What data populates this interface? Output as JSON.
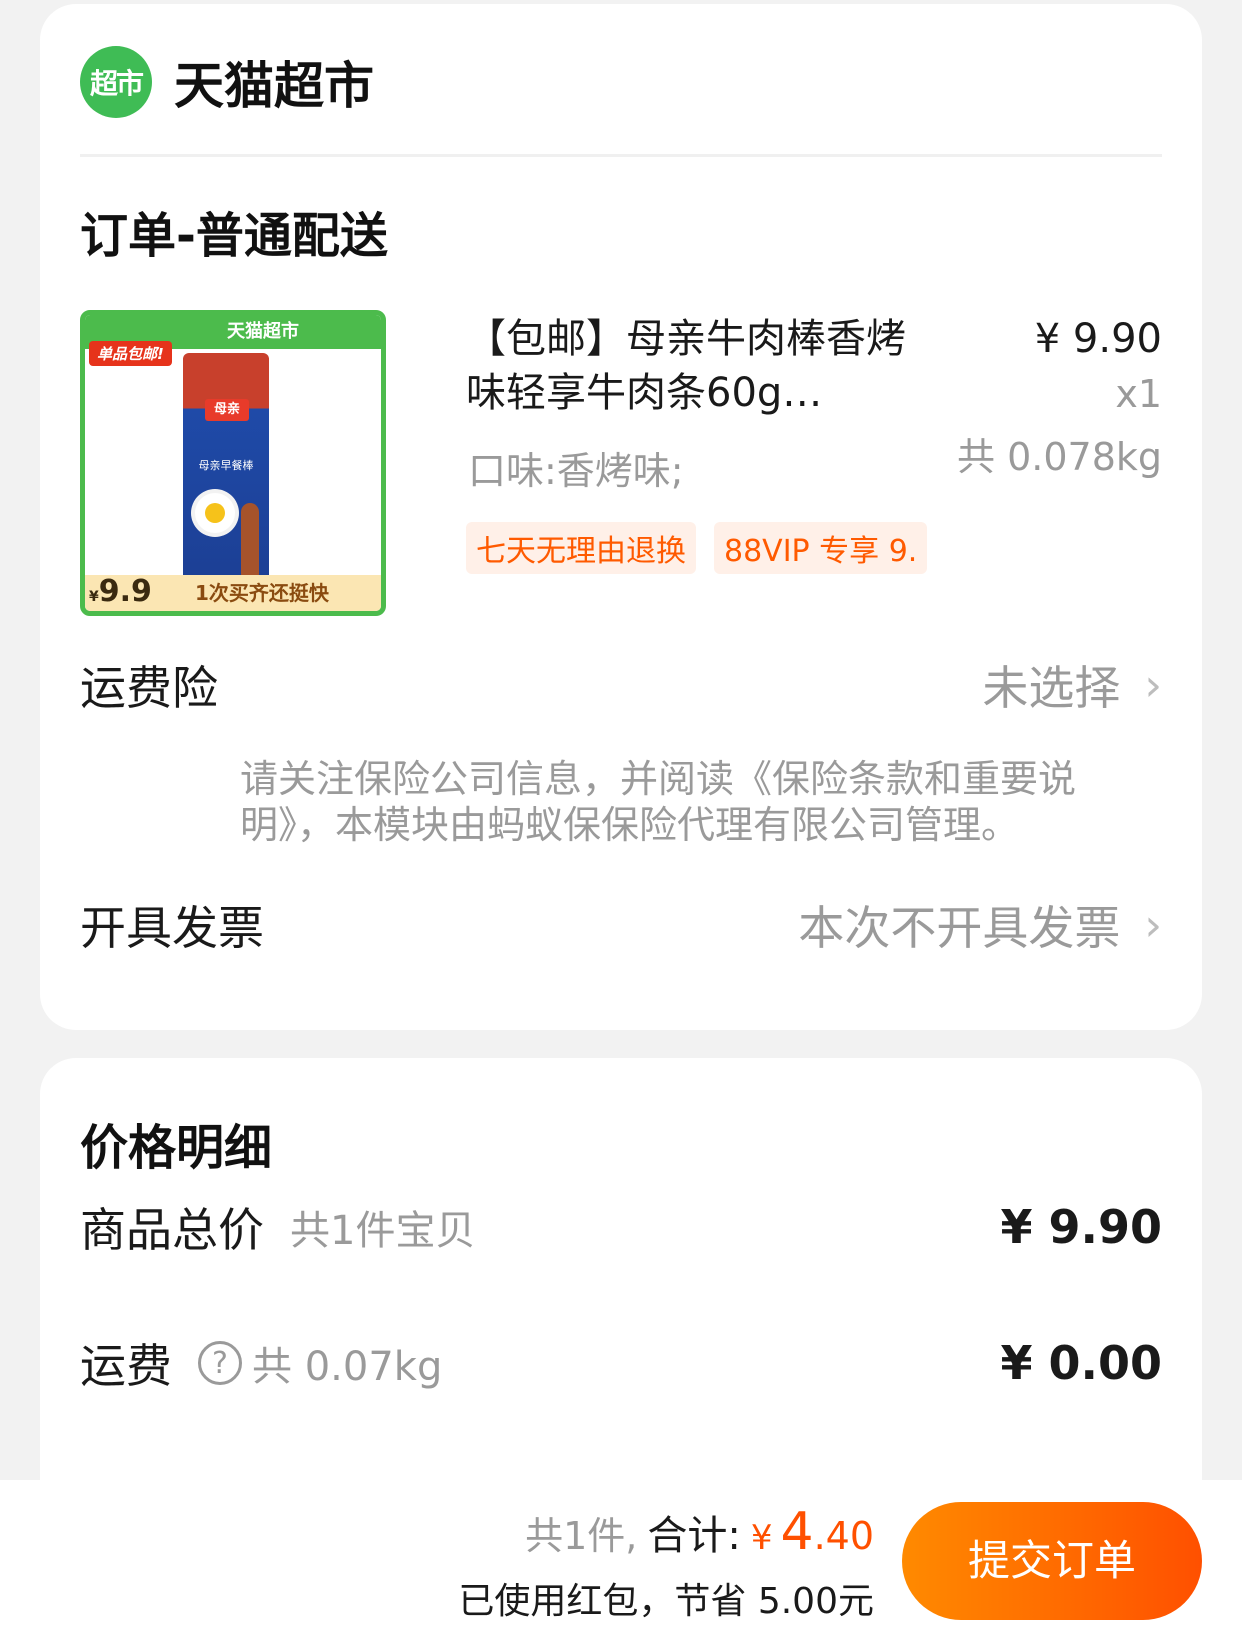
{
  "store": {
    "logo_text": "超市",
    "name": "天猫超市"
  },
  "order": {
    "title": "订单-普通配送"
  },
  "product": {
    "image": {
      "banner": "天猫超市",
      "tag": "单品包邮!",
      "brand": "母亲",
      "pack_text": "母亲早餐棒",
      "price_yen": "¥",
      "price": "9.9",
      "slogan": "1次买齐还挺快"
    },
    "title": "【包邮】母亲牛肉棒香烤味轻享牛肉条60g…",
    "spec": "口味:香烤味;",
    "price": "¥ 9.90",
    "qty": "x1",
    "weight": "共 0.078kg",
    "tags": [
      "七天无理由退换",
      "88VIP 专享 9."
    ]
  },
  "insurance": {
    "label": "运费险",
    "value": "未选择",
    "note": "请关注保险公司信息，并阅读《保险条款和重要说明》，本模块由蚂蚁保保险代理有限公司管理。"
  },
  "invoice": {
    "label": "开具发票",
    "value": "本次不开具发票"
  },
  "price_detail": {
    "title": "价格明细",
    "goods_label": "商品总价",
    "goods_sub": "共1件宝贝",
    "goods_amount": "¥ 9.90",
    "shipping_label": "运费",
    "shipping_sub": "共 0.07kg",
    "shipping_amount": "¥ 0.00"
  },
  "footer": {
    "count": "共1件,",
    "total_label": "合计:",
    "yen": "¥",
    "total_int": "4",
    "total_dec": ".40",
    "saved": "已使用红包，节省 5.00元",
    "submit": "提交订单"
  },
  "icons": {
    "chevron": "chevron-right-icon",
    "help": "question-circle-icon"
  },
  "colors": {
    "accent": "#ff5000",
    "store_green": "#3fbc55"
  }
}
